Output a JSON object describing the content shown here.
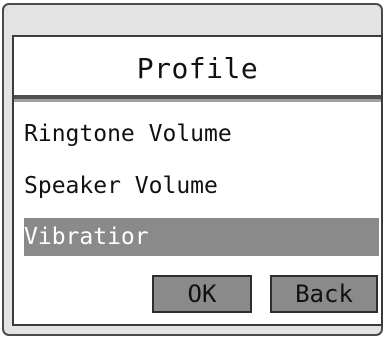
{
  "dialog": {
    "title": "Profile"
  },
  "menu": {
    "items": [
      {
        "label": "Ringtone Volume",
        "selected": false
      },
      {
        "label": "Speaker Volume",
        "selected": false
      },
      {
        "label": "Vibratior",
        "selected": true
      }
    ]
  },
  "buttons": {
    "ok_label": "OK",
    "back_label": "Back"
  },
  "colors": {
    "selection": "#8a8a8a",
    "frame": "#e3e3e3",
    "border": "#3c3c3c"
  }
}
